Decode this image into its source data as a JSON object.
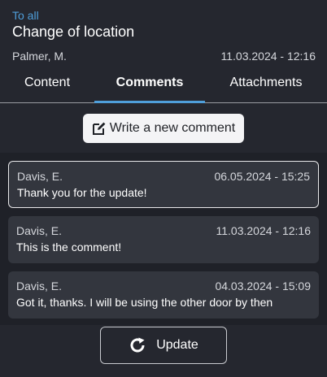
{
  "header": {
    "back_label": "To all",
    "title": "Change of location",
    "author": "Palmer, M.",
    "date": "11.03.2024 - 12:16"
  },
  "tabs": [
    {
      "label": "Content",
      "active": false
    },
    {
      "label": "Comments",
      "active": true
    },
    {
      "label": "Attachments",
      "active": false
    }
  ],
  "actions": {
    "new_comment_label": "Write a new comment",
    "new_comment_icon": "edit-icon",
    "update_label": "Update",
    "update_icon": "refresh-icon"
  },
  "comments": [
    {
      "author": "Davis, E.",
      "date": "06.05.2024 - 15:25",
      "text": "Thank you for the update!",
      "selected": true
    },
    {
      "author": "Davis, E.",
      "date": "11.03.2024 - 12:16",
      "text": "This is the comment!",
      "selected": false
    },
    {
      "author": "Davis, E.",
      "date": "04.03.2024 - 15:09",
      "text": "Got it, thanks. I will be using the other door by then",
      "selected": false
    }
  ],
  "colors": {
    "background": "#25272f",
    "accent": "#4f9fdb",
    "card": "#33363e"
  }
}
